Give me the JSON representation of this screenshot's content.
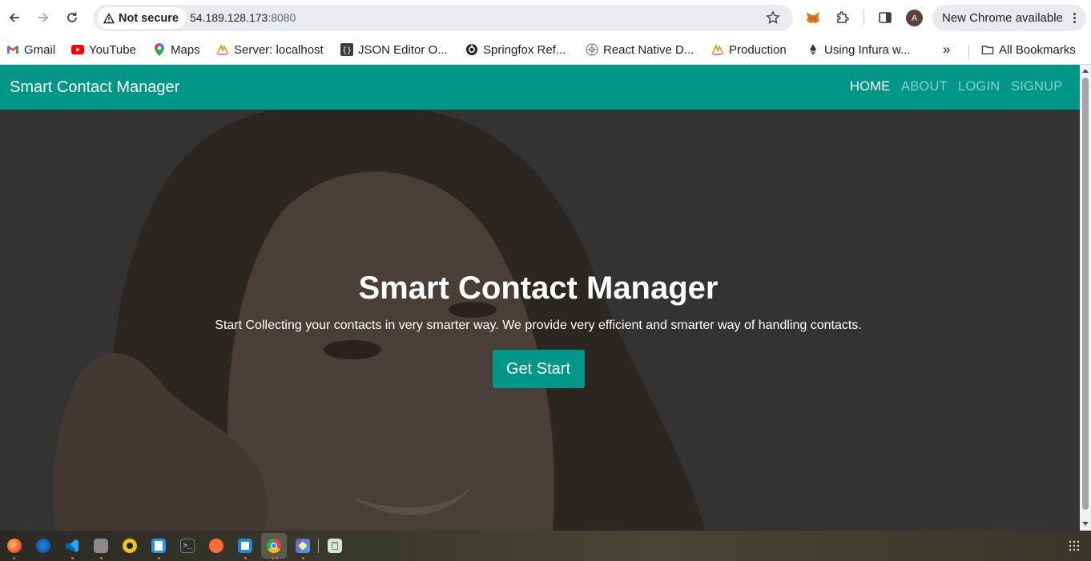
{
  "browser": {
    "security_label": "Not secure",
    "url_host": "54.189.128.173",
    "url_port": ":8080",
    "avatar_initial": "A",
    "update_label": "New Chrome available"
  },
  "bookmarks": [
    {
      "label": "Gmail",
      "icon": "gmail-icon"
    },
    {
      "label": "YouTube",
      "icon": "youtube-icon"
    },
    {
      "label": "Maps",
      "icon": "maps-icon"
    },
    {
      "label": "Server: localhost",
      "icon": "phpmyadmin-icon"
    },
    {
      "label": "JSON Editor O...",
      "icon": "json-icon"
    },
    {
      "label": "Springfox Ref...",
      "icon": "springfox-icon"
    },
    {
      "label": "React Native D...",
      "icon": "react-icon"
    },
    {
      "label": "Production",
      "icon": "phpmyadmin-icon"
    },
    {
      "label": "Using Infura w...",
      "icon": "ethereum-icon"
    }
  ],
  "bookmarks_overflow": "»",
  "all_bookmarks_label": "All Bookmarks",
  "site": {
    "brand": "Smart Contact Manager",
    "nav": [
      "HOME",
      "ABOUT",
      "LOGIN",
      "SIGNUP"
    ],
    "hero": {
      "title": "Smart Contact Manager",
      "text": "Start Collecting your contacts in very smarter way. We provide very efficient and smarter way of handling contacts.",
      "button": "Get Start"
    }
  },
  "colors": {
    "primary": "#009688",
    "hero_overlay": "#333333"
  }
}
